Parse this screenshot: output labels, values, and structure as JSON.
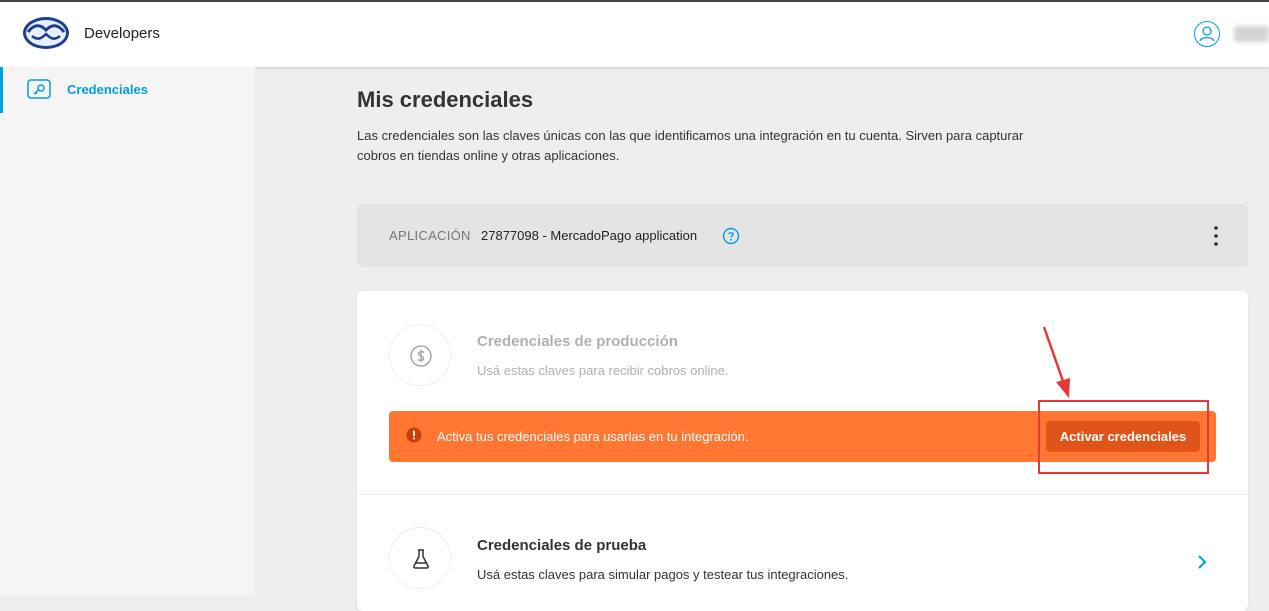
{
  "header": {
    "brand": "Developers",
    "user_name": "…"
  },
  "sidebar": {
    "items": [
      {
        "label": "Credenciales",
        "icon": "key-card-icon",
        "active": true
      }
    ]
  },
  "main": {
    "title": "Mis credenciales",
    "description": "Las credenciales son las claves únicas con las que identificamos una integración en tu cuenta. Sirven para capturar cobros en tiendas online y otras aplicaciones.",
    "application": {
      "label": "APLICACIÓN",
      "name": "27877098 - MercadoPago application"
    },
    "production": {
      "title": "Credenciales de producción",
      "description": "Usá estas claves para recibir cobros online.",
      "banner_text": "Activa tus credenciales para usarlas en tu integración.",
      "button_label": "Activar credenciales"
    },
    "test": {
      "title": "Credenciales de prueba",
      "description": "Usá estas claves para simular pagos y testear tus integraciones."
    }
  },
  "colors": {
    "accent": "#009ee3",
    "banner": "#ff7733",
    "button": "#e0541a",
    "annotation": "#e53935"
  }
}
